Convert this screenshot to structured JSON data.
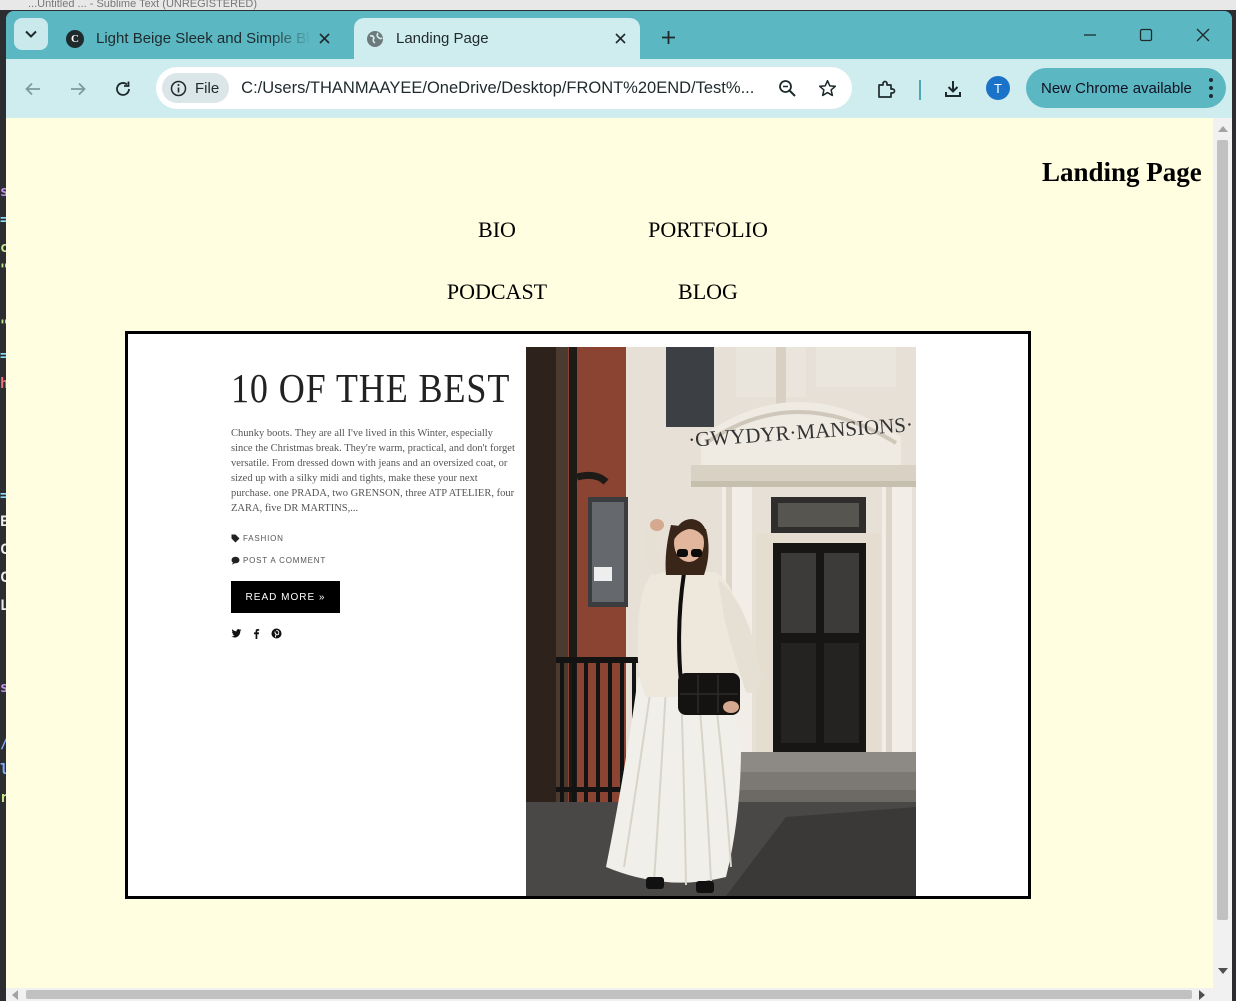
{
  "background_window": {
    "title_strip": "...Untitled ... - Sublime Text (UNREGISTERED)"
  },
  "browser": {
    "tabs": [
      {
        "title": "Light Beige Sleek and Simple Bl",
        "icon": "canva-icon",
        "active": false
      },
      {
        "title": "Landing Page",
        "icon": "globe-icon",
        "active": true
      }
    ],
    "toolbar": {
      "site_chip": "File",
      "url": "C:/Users/THANMAAYEE/OneDrive/Desktop/FRONT%20END/Test%...",
      "profile_initial": "T",
      "update_label": "New Chrome available"
    },
    "colors": {
      "frame": "#5bb7c2",
      "toolbar": "#cfecef",
      "page_background": "#fffee0"
    }
  },
  "page": {
    "heading": "Landing Page",
    "nav": {
      "bio": "BIO",
      "portfolio": "PORTFOLIO",
      "podcast": "PODCAST",
      "blog": "BLOG"
    },
    "hero": {
      "title": "10 OF THE BEST",
      "body": "Chunky boots. They are all I've lived in this Winter, especially since the Christmas break. They're warm, practical, and don't forget versatile. From dressed down with jeans and an oversized coat, or sized up with a silky midi and tights, make these your next purchase. one PRADA, two GRENSON, three ATP ATELIER, four ZARA, five DR MARTINS,...",
      "category": "FASHION",
      "comment": "POST A COMMENT",
      "read_more": "READ MORE »",
      "photo_sign": "·GWYDYR·MANSIONS·"
    }
  }
}
